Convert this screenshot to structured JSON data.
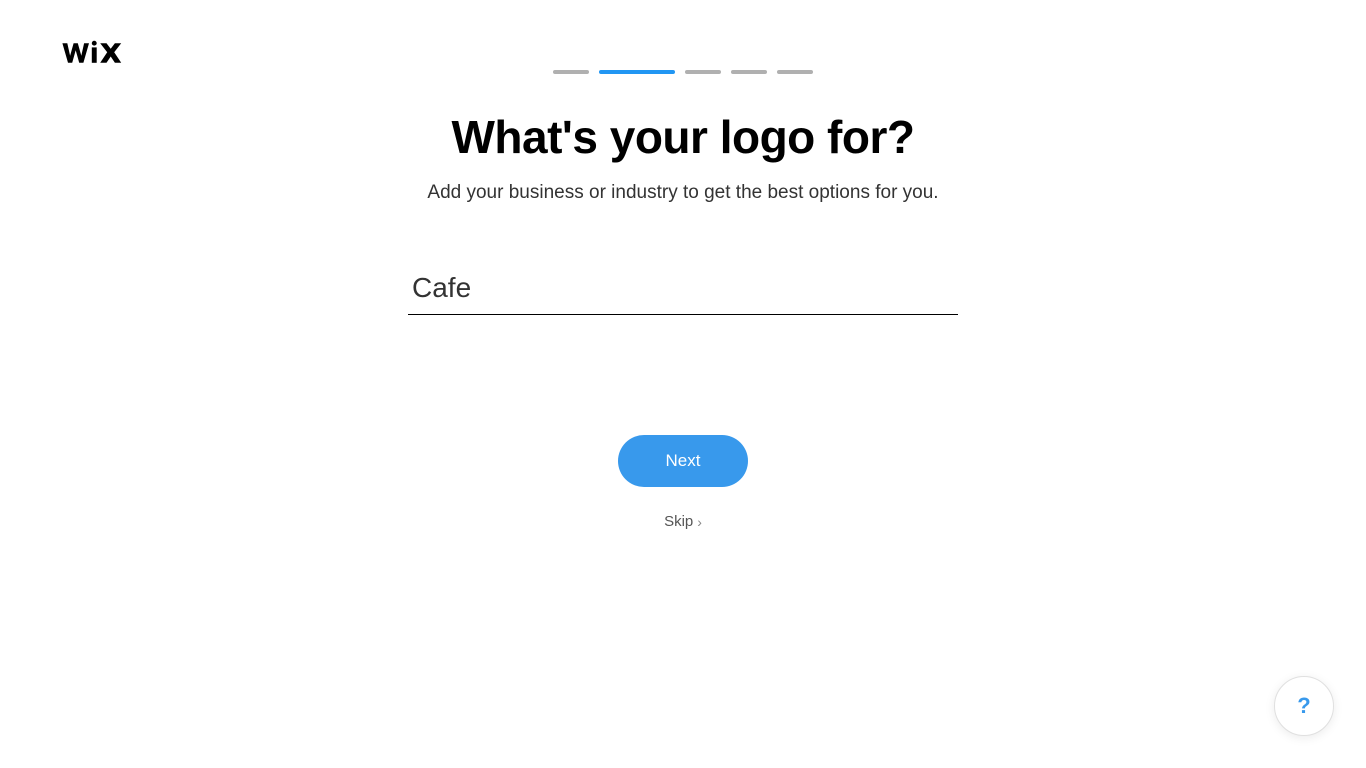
{
  "brand": "WiX",
  "progress": {
    "total_steps": 5,
    "active_step_index": 1
  },
  "main": {
    "heading": "What's your logo for?",
    "subheading": "Add your business or industry to get the best options for you.",
    "input_value": "Cafe",
    "input_placeholder": ""
  },
  "actions": {
    "next_label": "Next",
    "skip_label": "Skip"
  },
  "help": {
    "icon_label": "?"
  },
  "colors": {
    "accent": "#3899ec",
    "progress_active": "#2196f3",
    "progress_inactive": "#b0b0b0"
  }
}
